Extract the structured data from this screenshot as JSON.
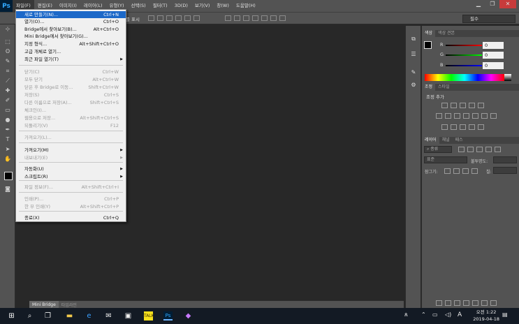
{
  "app": {
    "logo": "Ps"
  },
  "menubar": {
    "items": [
      "파일(F)",
      "편집(E)",
      "이미지(I)",
      "레이어(L)",
      "유형(Y)",
      "선택(S)",
      "필터(T)",
      "3D(D)",
      "보기(V)",
      "창(W)",
      "도움말(H)"
    ]
  },
  "window_controls": {
    "minimize": "▁",
    "restore": "❐",
    "close": "✕"
  },
  "options_bar": {
    "display_label": "를 표시",
    "workspace": "필수"
  },
  "file_menu": {
    "items": [
      {
        "label": "새로 만들기(N)...",
        "shortcut": "Ctrl+N",
        "disabled": false,
        "highlight": true
      },
      {
        "label": "열기(O)...",
        "shortcut": "Ctrl+O",
        "disabled": false
      },
      {
        "label": "Bridge에서 찾아보기(B)...",
        "shortcut": "Alt+Ctrl+O",
        "disabled": false
      },
      {
        "label": "Mini Bridge에서 찾아보기(G)...",
        "shortcut": "",
        "disabled": false
      },
      {
        "label": "지정 형식...",
        "shortcut": "Alt+Shift+Ctrl+O",
        "disabled": false
      },
      {
        "label": "고급 개체로 열기...",
        "shortcut": "",
        "disabled": false
      },
      {
        "label": "최근 파일 열기(T)",
        "shortcut": "",
        "disabled": false,
        "submenu": true
      },
      {
        "label": "닫기(C)",
        "shortcut": "Ctrl+W",
        "disabled": true
      },
      {
        "label": "모두 닫기",
        "shortcut": "Alt+Ctrl+W",
        "disabled": true
      },
      {
        "label": "닫은 후 Bridge로 이동...",
        "shortcut": "Shift+Ctrl+W",
        "disabled": true
      },
      {
        "label": "저장(S)",
        "shortcut": "Ctrl+S",
        "disabled": true
      },
      {
        "label": "다른 이름으로 저장(A)...",
        "shortcut": "Shift+Ctrl+S",
        "disabled": true
      },
      {
        "label": "체크인(I)...",
        "shortcut": "",
        "disabled": true
      },
      {
        "label": "웹용으로 저장...",
        "shortcut": "Alt+Shift+Ctrl+S",
        "disabled": true
      },
      {
        "label": "되돌리기(V)",
        "shortcut": "F12",
        "disabled": true
      },
      {
        "label": "가져오기(L)...",
        "shortcut": "",
        "disabled": true
      },
      {
        "label": "가져오기(M)",
        "shortcut": "",
        "disabled": false,
        "submenu": true
      },
      {
        "label": "내보내기(E)",
        "shortcut": "",
        "disabled": true,
        "submenu": true
      },
      {
        "label": "자동화(U)",
        "shortcut": "",
        "disabled": false,
        "submenu": true
      },
      {
        "label": "스크립트(R)",
        "shortcut": "",
        "disabled": false,
        "submenu": true
      },
      {
        "label": "파일 정보(F)...",
        "shortcut": "Alt+Shift+Ctrl+I",
        "disabled": true
      },
      {
        "label": "인쇄(P)...",
        "shortcut": "Ctrl+P",
        "disabled": true
      },
      {
        "label": "한 부 인쇄(Y)",
        "shortcut": "Alt+Shift+Ctrl+P",
        "disabled": true
      },
      {
        "label": "종료(X)",
        "shortcut": "Ctrl+Q",
        "disabled": false
      }
    ]
  },
  "color_panel": {
    "tabs": [
      "색상",
      "색상 견본"
    ],
    "r_label": "R",
    "g_label": "G",
    "b_label": "B",
    "r_value": "0",
    "g_value": "0",
    "b_value": "0"
  },
  "adjust_panel": {
    "tabs": [
      "조정",
      "스타일"
    ],
    "title": "조정 추가"
  },
  "layers_panel": {
    "tabs": [
      "레이어",
      "채널",
      "패스"
    ],
    "filter": "종류",
    "blend_mode": "표준",
    "opacity_label": "불투명도:",
    "lock_label": "잠그기:",
    "fill_label": "칠:"
  },
  "bottom_tabs": [
    "Mini Bridge",
    "타임라인"
  ],
  "taskbar": {
    "time": "오전 1:22",
    "date": "2019-04-18",
    "lang": "A"
  }
}
